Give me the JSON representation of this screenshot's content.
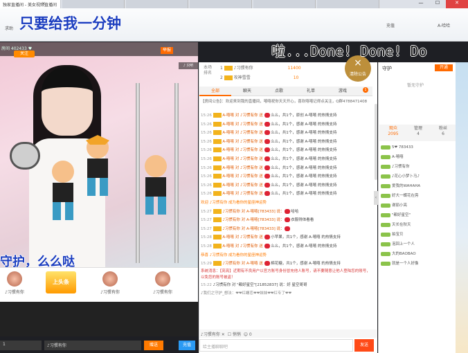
{
  "browser": {
    "tab_title": "独家直播间 - 美女视频直播间",
    "close": "×",
    "window": {
      "minimize": "—",
      "maximize": "☐",
      "close": "✕"
    }
  },
  "header": {
    "sub_title": "求助",
    "overlay_top": "只要给我一分钟",
    "recharge": "充值",
    "user": "A-哈哈",
    "danmu": "啦...Done! Done! Do"
  },
  "player": {
    "room_line": "房间 402433 ♥",
    "follow": "关注",
    "report": "举报",
    "tag": "♪ 只听",
    "overlay_bottom": "守护，么么哒"
  },
  "gifts": [
    {
      "label": "♪习惯有你",
      "badge": ""
    },
    {
      "label": "上头条",
      "badge": "上头条"
    },
    {
      "label": "♪习惯有你",
      "badge": ""
    },
    {
      "label": "♪习惯有你",
      "badge": ""
    }
  ],
  "bottom_bar": {
    "count": "1",
    "recipient": "♪习惯有你",
    "send": "赠送",
    "go": "充值"
  },
  "ranking": {
    "head1": "本场",
    "head2": "排名",
    "rows": [
      {
        "n": "1",
        "name": "♪习惯有你",
        "score": "11400"
      },
      {
        "n": "2",
        "name": "攻神雪雪",
        "score": "10"
      }
    ]
  },
  "notice_badge": {
    "symbol": "×",
    "label": "清除公告"
  },
  "chat_tabs": [
    "全部",
    "聊天",
    "点歌",
    "礼单",
    "游戏"
  ],
  "chat_badge": "1",
  "announcement": "【房间公告】：欢迎来到我的直播间，嘻嘻祝你天天开心，喜欢嘻嘻记得点关注，Q群4788471408",
  "chat": [
    {
      "t": "15:26",
      "text": "A-嘻嘻 对 ♪习惯有你 送 ",
      "gift": "么么，共1个，原创 A-嘻嘻 的热情支持"
    },
    {
      "t": "15:26",
      "text": "A-嘻嘻 对 ♪习惯有你 送 ",
      "gift": "么么，共1个，感谢 A-嘻嘻 的热情支持"
    },
    {
      "t": "15:26",
      "text": "A-嘻嘻 对 ♪习惯有你 送 ",
      "gift": "么么，共1个，感谢 A-嘻嘻 的热情支持"
    },
    {
      "t": "15:26",
      "text": "A-嘻嘻 对 ♪习惯有你 送 ",
      "gift": "么么，共1个，感谢 A-嘻嘻 的热情支持"
    },
    {
      "t": "15:26",
      "text": "A-嘻嘻 对 ♪习惯有你 送 ",
      "gift": "么么，共1个，感谢 A-嘻嘻 的热情支持"
    },
    {
      "t": "15:26",
      "text": "A-嘻嘻 对 ♪习惯有你 送 ",
      "gift": "么么，共1个，感谢 A-嘻嘻 的热情支持"
    },
    {
      "t": "15:26",
      "text": "A-嘻嘻 对 ♪习惯有你 送 ",
      "gift": "么么，共1个，感谢 A-嘻嘻 的热情支持"
    },
    {
      "t": "15:26",
      "text": "A-嘻嘻 对 ♪习惯有你 送 ",
      "gift": "么么，共1个，感谢 A-嘻嘻 的热情支持"
    },
    {
      "t": "15:26",
      "text": "A-嘻嘻 对 ♪习惯有你 送 ",
      "gift": "么么，共1个，感谢 A-嘻嘻 的热情支持"
    },
    {
      "t": "15:26",
      "text": "A-嘻嘻 对 ♪习惯有你 送 ",
      "gift": "么么，共1个，感谢 A-嘻嘻 的热情支持"
    },
    {
      "t": "",
      "text": "",
      "gift": "",
      "welcome": "欢迎 ♪习惯有你 成为看你的星座神运势"
    },
    {
      "t": "15:27",
      "text": "♪习惯有你 对 A-嘻嘻[783433] 说：",
      "gift": "哈哈"
    },
    {
      "t": "15:27",
      "text": "♪习惯有你 对 A-嘻嘻[783433] 说：",
      "gift": "衣服得体看看"
    },
    {
      "t": "15:27",
      "text": "♪习惯有你 对 A-嘻嘻[783433] 说：",
      "gift": ""
    },
    {
      "t": "15:28",
      "text": "A-嘻嘻 对 ♪习惯有你 送 ",
      "gift": "小苹果，共1个，感谢 A-嘻嘻 的热情支持"
    },
    {
      "t": "15:28",
      "text": "A-嘻嘻 对 ♪习惯有你 送 ",
      "gift": "么么，共1个，感谢 A-嘻嘻 的热情支持"
    },
    {
      "t": "",
      "text": "",
      "gift": "",
      "welcome": "恭喜 ♪习惯有你 成为看你的星座神运势"
    },
    {
      "t": "15:29",
      "text": "♪习惯有你 对 A-嘻嘻 送 ",
      "gift": "棉花糖，共1个，感谢 A-嘻嘻 的热情支持"
    }
  ],
  "system_msg": "系统消息：【亮亮】近期有不良用户以官方账号身份冒充他人账号，请不要随意让他人登陆您的账号，以免您的账号被盗！",
  "last_msg": {
    "t": "15:22",
    "text": "♪习惯有你 对 \"都好星空\"[21852837] 说：好 星空哥哥"
  },
  "input_tip": "♪我们之守护_想法：❤❤红螺恋❤❤妹妹❤❤红专了❤❤",
  "input_bar": {
    "target": "♪习惯有你",
    "check": "悄悄",
    "count": "0"
  },
  "chat_input": {
    "placeholder": "给主播聊聊吧",
    "send": "发送"
  },
  "guard": {
    "title": "守护",
    "open": "开通",
    "empty": "暂无守护"
  },
  "stats": [
    {
      "label": "观众",
      "value": "2095"
    },
    {
      "label": "管理",
      "value": "4"
    },
    {
      "label": "粉丝",
      "value": "6"
    }
  ],
  "users": [
    {
      "name": "5❤ 783433"
    },
    {
      "name": "A-嘻嘻"
    },
    {
      "name": "♪习惯有你"
    },
    {
      "name": "♪花心小梦卜马♪"
    },
    {
      "name": "爱我的WAHAHA"
    },
    {
      "name": "好大一蝶花在旁"
    },
    {
      "name": "谢丽小亮"
    },
    {
      "name": "\"都好星空\""
    },
    {
      "name": "天长在秋天"
    },
    {
      "name": "拍宝贝"
    },
    {
      "name": "泡回上一个人"
    },
    {
      "name": "大的BAOBAO"
    },
    {
      "name": "就是一个人好像"
    }
  ]
}
